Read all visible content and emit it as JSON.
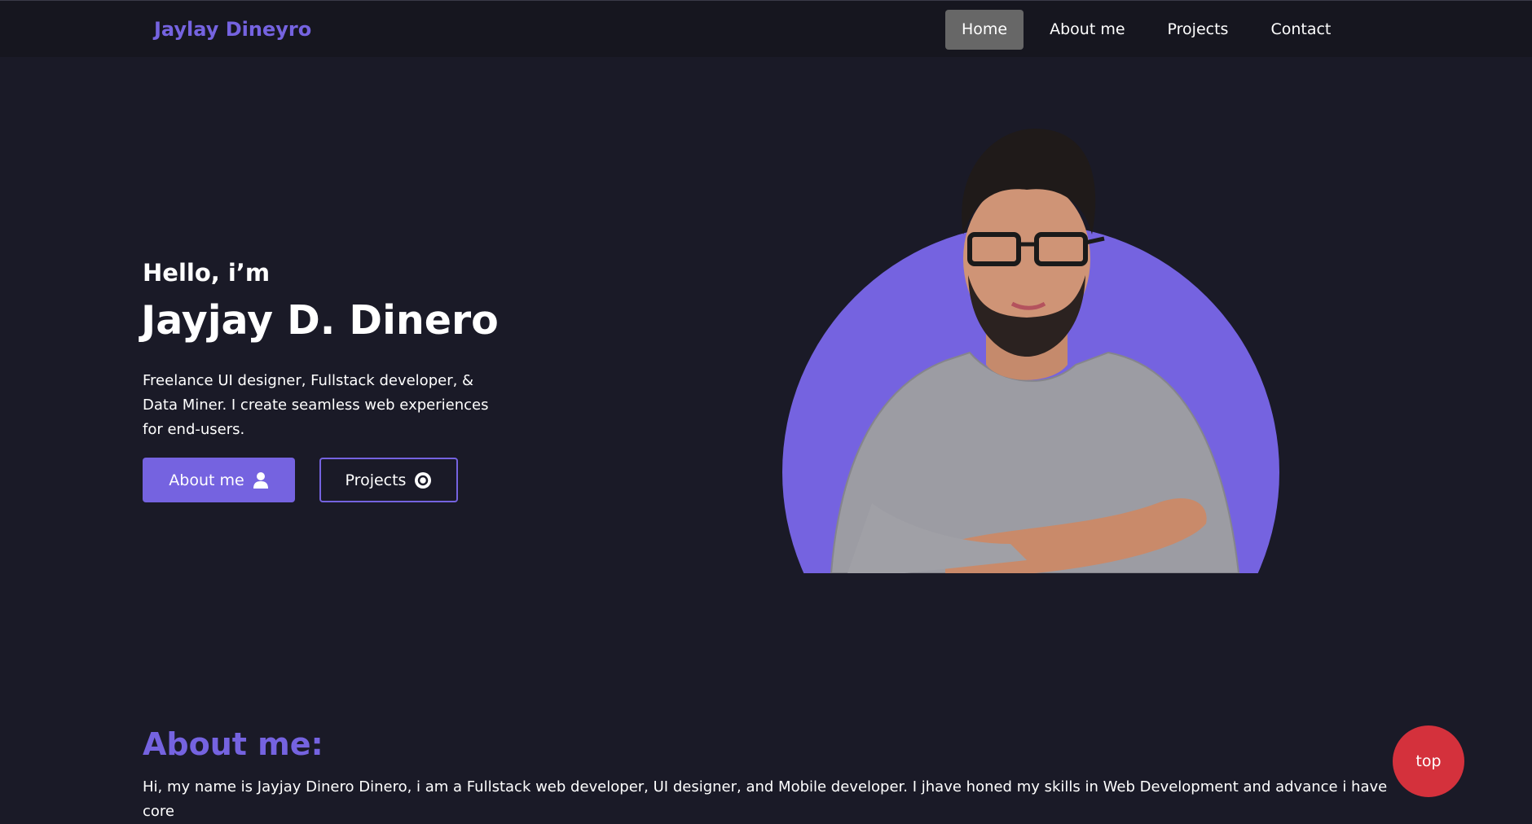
{
  "navbar": {
    "brand": "Jaylay Dineyro",
    "links": [
      {
        "label": "Home",
        "active": true
      },
      {
        "label": "About me",
        "active": false
      },
      {
        "label": "Projects",
        "active": false
      },
      {
        "label": "Contact",
        "active": false
      }
    ]
  },
  "hero": {
    "greeting": "Hello, i’m",
    "name": "Jayjay D. Dinero",
    "description": "Freelance UI designer, Fullstack developer, & Data Miner. I create seamless web experiences for end-users.",
    "about_button": {
      "label": "About me",
      "icon": "user-icon"
    },
    "projects_button": {
      "label": "Projects",
      "icon": "circle-icon"
    }
  },
  "about": {
    "title": "About me:",
    "text": "Hi, my name is Jayjay Dinero Dinero, i am a Fullstack web developer, UI designer, and Mobile developer. I jhave honed my skills in Web Development and advance i have core"
  },
  "top_button": {
    "label": "top"
  },
  "colors": {
    "accent": "#7563e0",
    "background": "#1a1a27",
    "nav_background": "#16161f",
    "active_nav": "#676767",
    "top_button": "#d4313c"
  }
}
